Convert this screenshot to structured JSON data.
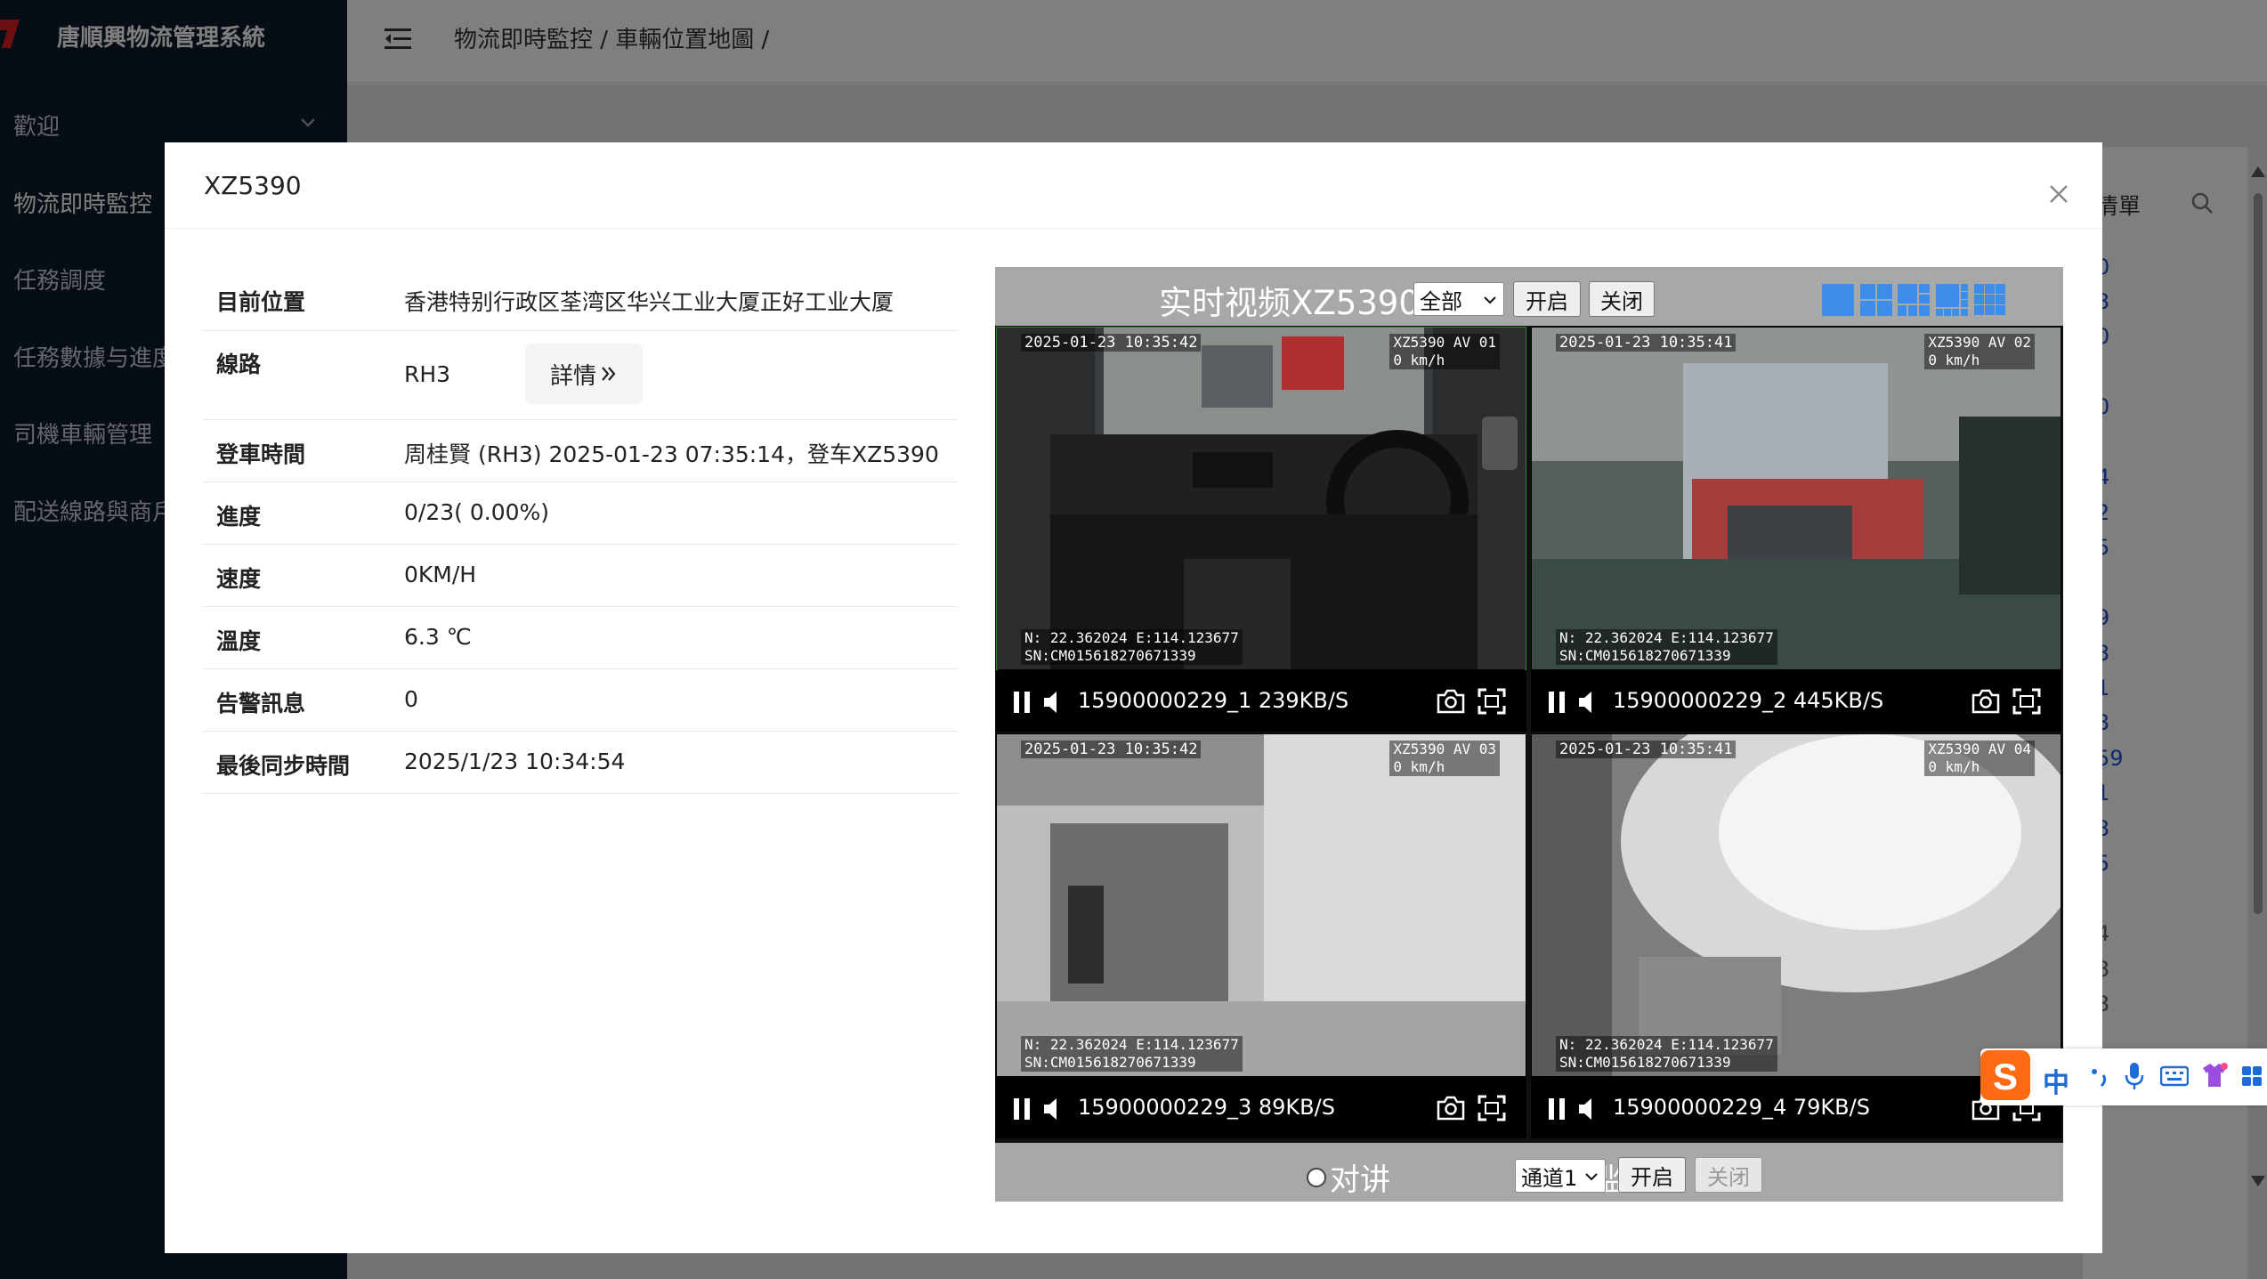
{
  "app": {
    "title": "唐順興物流管理系統"
  },
  "sidebar": {
    "items": [
      {
        "label": "歡迎"
      },
      {
        "label": "物流即時監控"
      },
      {
        "label": "任務調度"
      },
      {
        "label": "任務數據与進度"
      },
      {
        "label": "司機車輛管理"
      },
      {
        "label": "配送線路與商戶"
      }
    ]
  },
  "header": {
    "breadcrumb": "物流即時監控 / 車輛位置地圖 /"
  },
  "background": {
    "list_title": "清單",
    "numbers": [
      "0",
      "3",
      "0",
      "0",
      "4",
      "2",
      "5",
      "9",
      "3",
      "1",
      "3",
      "59",
      "1",
      "3",
      "5",
      "4",
      "3",
      "3"
    ]
  },
  "modal": {
    "title": "XZ5390",
    "info": [
      {
        "label": "目前位置",
        "value": "香港特别行政区荃湾区华兴工业大厦正好工业大厦"
      },
      {
        "label": "線路",
        "value": "RH3",
        "button": "詳情"
      },
      {
        "label": "登車時間",
        "value": "周桂賢 (RH3) 2025-01-23 07:35:14，登车XZ5390"
      },
      {
        "label": "進度",
        "value": "0/23( 0.00%)"
      },
      {
        "label": "速度",
        "value": "0KM/H"
      },
      {
        "label": "溫度",
        "value": "6.3 ℃"
      },
      {
        "label": "告警訊息",
        "value": "0"
      },
      {
        "label": "最後同步時間",
        "value": "2025/1/23 10:34:54"
      }
    ]
  },
  "video": {
    "title": "实时视频XZ5390",
    "channel_select": "全部",
    "open_label": "开启",
    "close_label": "关闭",
    "cells": [
      {
        "timestamp": "2025-01-23 10:35:42",
        "osd": "XZ5390 AV 01\n0 km/h",
        "gps": "N: 22.362024 E:114.123677\nSN:CM015618270671339",
        "stream": "15900000229_1 239KB/S"
      },
      {
        "timestamp": "2025-01-23 10:35:41",
        "osd": "XZ5390 AV 02\n0 km/h",
        "gps": "N: 22.362024 E:114.123677\nSN:CM015618270671339",
        "stream": "15900000229_2 445KB/S"
      },
      {
        "timestamp": "2025-01-23 10:35:42",
        "osd": "XZ5390 AV 03\n0 km/h",
        "gps": "N: 22.362024 E:114.123677\nSN:CM015618270671339",
        "stream": "15900000229_3 89KB/S"
      },
      {
        "timestamp": "2025-01-23 10:35:41",
        "osd": "XZ5390 AV 04\n0 km/h",
        "gps": "N: 22.362024 E:114.123677\nSN:CM015618270671339",
        "stream": "15900000229_4 79KB/S"
      }
    ],
    "talk_label": "对讲",
    "listen_label": "监听",
    "audio_channel": "通道1",
    "audio_open": "开启",
    "audio_close": "关闭"
  },
  "ime": {
    "lang": "中"
  },
  "colors": {
    "sidebar_bg": "#0e1a2b",
    "brand_red": "#d81e24",
    "layout_icon_blue": "#3d8eea"
  }
}
